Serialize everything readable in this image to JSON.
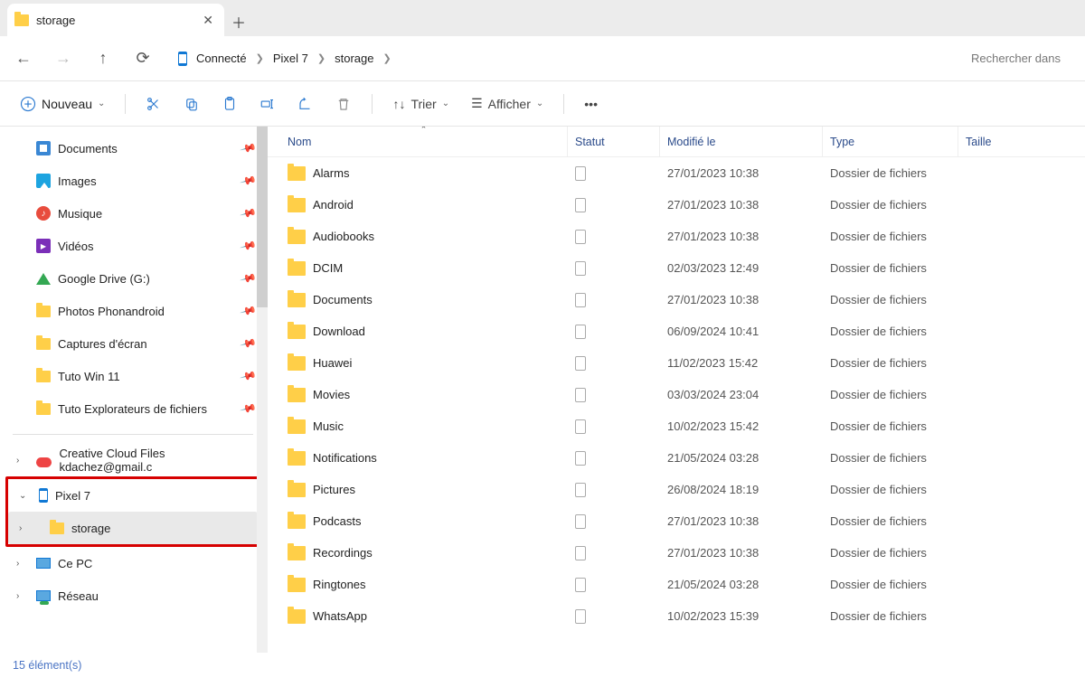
{
  "tab": {
    "title": "storage"
  },
  "breadcrumb": {
    "root_label": "Connecté",
    "items": [
      "Pixel 7",
      "storage"
    ]
  },
  "search": {
    "placeholder": "Rechercher dans"
  },
  "toolbar": {
    "new_label": "Nouveau",
    "sort_label": "Trier",
    "view_label": "Afficher"
  },
  "sidebar": {
    "pinned": [
      {
        "label": "Documents",
        "icon": "docs"
      },
      {
        "label": "Images",
        "icon": "img"
      },
      {
        "label": "Musique",
        "icon": "music"
      },
      {
        "label": "Vidéos",
        "icon": "vid"
      },
      {
        "label": "Google Drive (G:)",
        "icon": "gdrive"
      },
      {
        "label": "Photos Phonandroid",
        "icon": "folder"
      },
      {
        "label": "Captures d'écran",
        "icon": "folder"
      },
      {
        "label": "Tuto Win 11",
        "icon": "folder"
      },
      {
        "label": "Tuto Explorateurs de fichiers",
        "icon": "folder"
      }
    ],
    "tree": [
      {
        "label": "Creative Cloud Files  kdachez@gmail.c",
        "icon": "cloud",
        "expander": "›"
      },
      {
        "label": "Pixel 7",
        "icon": "phone",
        "expander": "⌄",
        "highlight": true
      },
      {
        "label": "storage",
        "icon": "folder",
        "expander": "›",
        "indent": 1,
        "highlight": true,
        "selected": true
      },
      {
        "label": "Ce PC",
        "icon": "pc",
        "expander": "›"
      },
      {
        "label": "Réseau",
        "icon": "net",
        "expander": "›"
      }
    ]
  },
  "columns": {
    "name": "Nom",
    "status": "Statut",
    "modified": "Modifié le",
    "type": "Type",
    "size": "Taille"
  },
  "rows": [
    {
      "name": "Alarms",
      "modified": "27/01/2023 10:38",
      "type": "Dossier de fichiers"
    },
    {
      "name": "Android",
      "modified": "27/01/2023 10:38",
      "type": "Dossier de fichiers"
    },
    {
      "name": "Audiobooks",
      "modified": "27/01/2023 10:38",
      "type": "Dossier de fichiers"
    },
    {
      "name": "DCIM",
      "modified": "02/03/2023 12:49",
      "type": "Dossier de fichiers"
    },
    {
      "name": "Documents",
      "modified": "27/01/2023 10:38",
      "type": "Dossier de fichiers"
    },
    {
      "name": "Download",
      "modified": "06/09/2024 10:41",
      "type": "Dossier de fichiers"
    },
    {
      "name": "Huawei",
      "modified": "11/02/2023 15:42",
      "type": "Dossier de fichiers"
    },
    {
      "name": "Movies",
      "modified": "03/03/2024 23:04",
      "type": "Dossier de fichiers"
    },
    {
      "name": "Music",
      "modified": "10/02/2023 15:42",
      "type": "Dossier de fichiers"
    },
    {
      "name": "Notifications",
      "modified": "21/05/2024 03:28",
      "type": "Dossier de fichiers"
    },
    {
      "name": "Pictures",
      "modified": "26/08/2024 18:19",
      "type": "Dossier de fichiers"
    },
    {
      "name": "Podcasts",
      "modified": "27/01/2023 10:38",
      "type": "Dossier de fichiers"
    },
    {
      "name": "Recordings",
      "modified": "27/01/2023 10:38",
      "type": "Dossier de fichiers"
    },
    {
      "name": "Ringtones",
      "modified": "21/05/2024 03:28",
      "type": "Dossier de fichiers"
    },
    {
      "name": "WhatsApp",
      "modified": "10/02/2023 15:39",
      "type": "Dossier de fichiers"
    }
  ],
  "statusbar": {
    "count_label": "15 élément(s)"
  }
}
